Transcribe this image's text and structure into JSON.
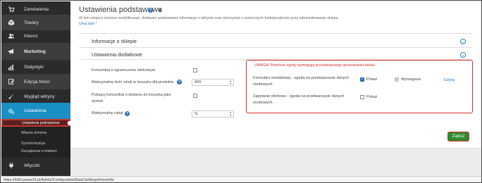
{
  "sidebar": {
    "items": [
      {
        "label": "Zamówienia",
        "icon": "cart-icon"
      },
      {
        "label": "Towary",
        "icon": "box-icon"
      },
      {
        "label": "Klienci",
        "icon": "users-icon"
      },
      {
        "label": "Marketing",
        "icon": "megaphone-icon"
      },
      {
        "label": "Statystyki",
        "icon": "stats-icon"
      },
      {
        "label": "Edycja treści",
        "icon": "edit-icon"
      },
      {
        "label": "Wygląd witryny",
        "icon": "brush-icon"
      },
      {
        "label": "Ustawienia",
        "icon": "gears-icon"
      },
      {
        "label": "Wtyczki",
        "icon": "plug-icon"
      }
    ],
    "sub_items": [
      "Ustawienia podstawowe",
      "Własna domena",
      "Synchronizacja",
      "Zarządzanie e-mailami"
    ]
  },
  "page": {
    "title": "Ustawienia podstawowe",
    "subtitle": "W tym miejscu możesz modyfikować, dodawać podstawowe informacje o witrynie oraz skorzystać z pomocnych funkcjonalności przy administrowaniu sklepu.",
    "learn_more": "Ukryj opis ^"
  },
  "sections": {
    "info": "Informacje o sklepie",
    "additional": "Ustawienia dodatkowe"
  },
  "settings": {
    "age_limit_label": "Komunikat o ograniczeniu wiekowym",
    "max_items_label": "Maksymalna ilość sztuk w koszyku dla produktu",
    "max_items_value": "999",
    "show_added_msg_label": "Pokazuj komunikat o dodaniu do koszyka jako dymek",
    "max_discount_label": "Maksymalny rabat",
    "max_discount_value": "%"
  },
  "consents": {
    "warning": "UWAGA! Poniższe zgody wymagają wcześniejszego opracowania tekstu.",
    "contact_form_label": "Formularz kontaktowy - zgoda na przetwarzanie danych osobowych",
    "offer_request_label": "Zapytanie ofertowe - zgoda na przetwarzanie danych osobowych",
    "show_label": "Pokaż",
    "required_label": "Wymagana",
    "edit_label": "Edytuj"
  },
  "actions": {
    "save_label": "Zapisz"
  },
  "statusbar": {
    "url": "https://ht93.pasaz24.pl/Admin/Configuration/BasicSettings#moreInfo"
  },
  "colors": {
    "sidebar_bg": "#2b2b2b",
    "active_accent": "#1a8fc4",
    "save_green": "#2e8b2e",
    "highlight_red": "#d32f2f"
  }
}
